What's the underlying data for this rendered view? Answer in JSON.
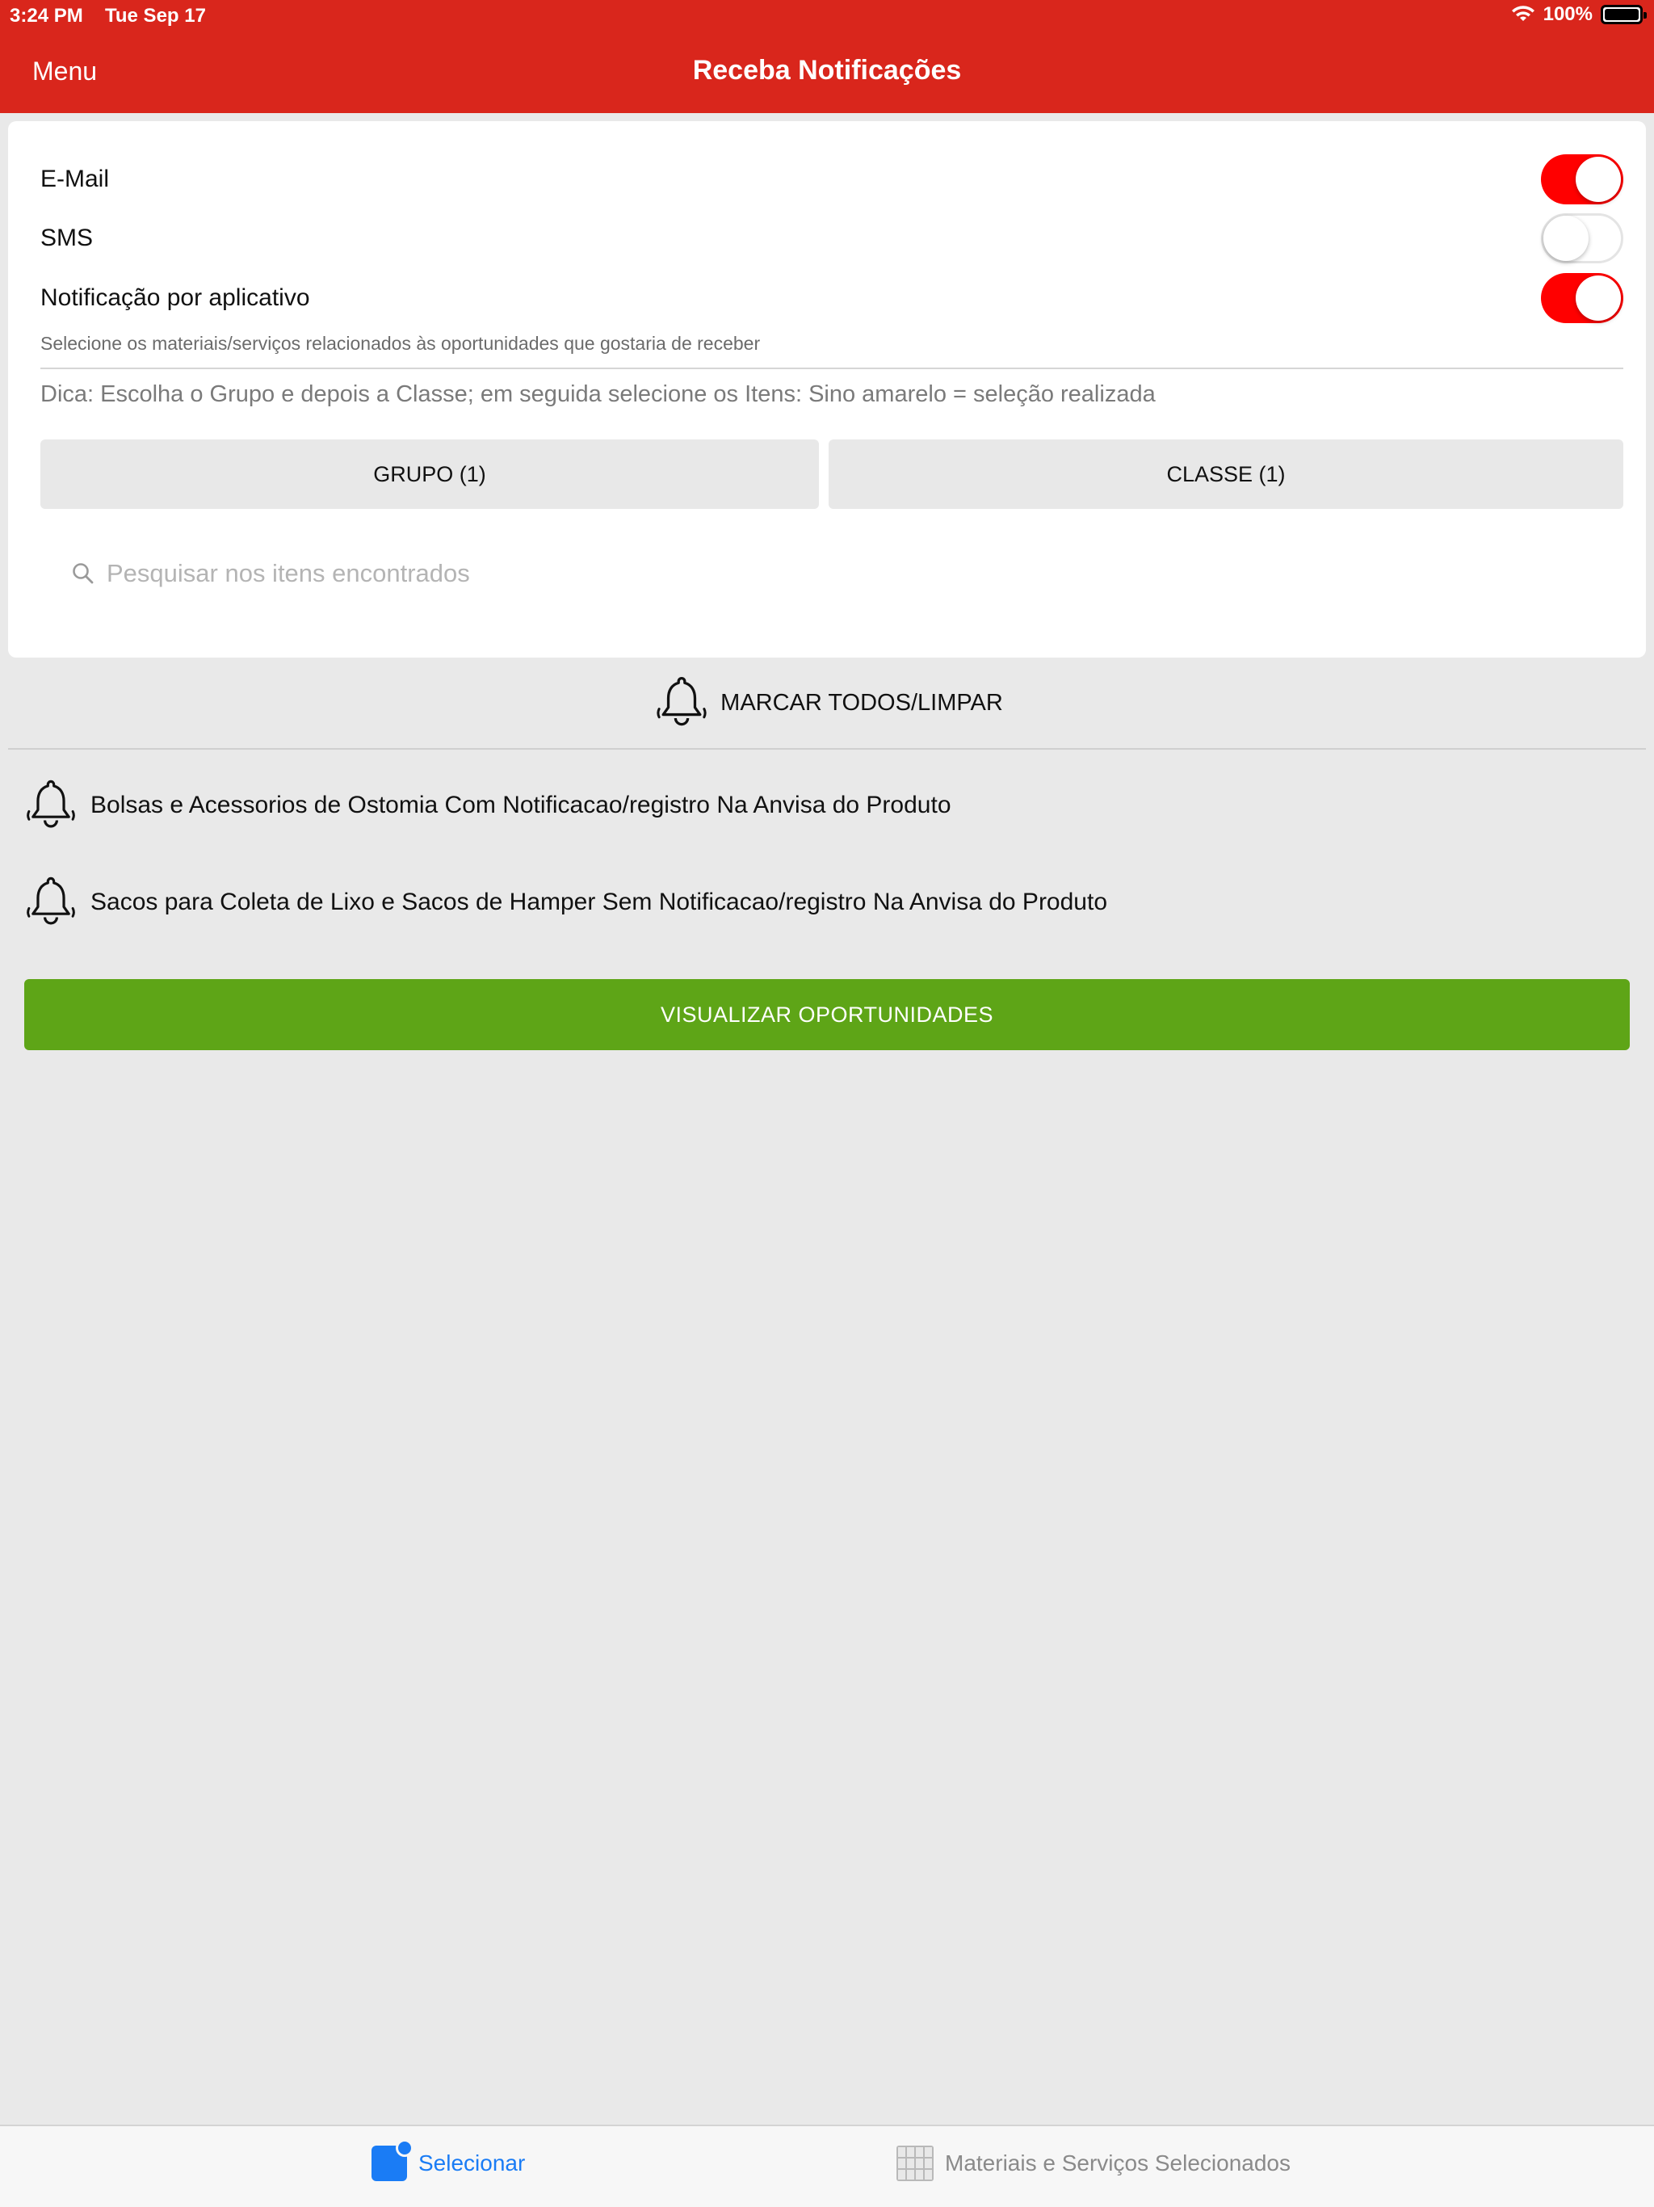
{
  "status_bar": {
    "time": "3:24 PM",
    "date": "Tue Sep 17",
    "battery": "100%",
    "wifi_icon": "wifi-icon",
    "battery_icon": "battery-icon"
  },
  "nav": {
    "menu_label": "Menu",
    "title": "Receba Notificações"
  },
  "toggles": [
    {
      "label": "E-Mail",
      "on": true
    },
    {
      "label": "SMS",
      "on": false
    },
    {
      "label": "Notificação por aplicativo",
      "on": true
    }
  ],
  "instruction": "Selecione os materiais/serviços relacionados às oportunidades que gostaria de receber",
  "tip": "Dica: Escolha o Grupo e depois a Classe; em seguida selecione os Itens: Sino  amarelo = seleção realizada",
  "segments": {
    "grupo": "GRUPO (1)",
    "classe": "CLASSE (1)"
  },
  "search": {
    "placeholder": "Pesquisar nos itens encontrados",
    "value": ""
  },
  "mark_all_label": "MARCAR TODOS/LIMPAR",
  "items": [
    {
      "label": "Bolsas e Acessorios de Ostomia Com Notificacao/registro Na Anvisa do Produto",
      "selected": false
    },
    {
      "label": "Sacos para Coleta de Lixo e Sacos de Hamper Sem Notificacao/registro Na Anvisa do Produto",
      "selected": false
    }
  ],
  "cta_label": "VISUALIZAR OPORTUNIDADES",
  "colors": {
    "header": "#d9261c",
    "toggle_on": "#ff0000",
    "cta": "#5ea517",
    "tab_active": "#1a7cf5"
  },
  "tabbar": {
    "tabs": [
      {
        "label": "Selecionar",
        "active": true
      },
      {
        "label": "Materiais e Serviços Selecionados",
        "active": false
      }
    ]
  }
}
